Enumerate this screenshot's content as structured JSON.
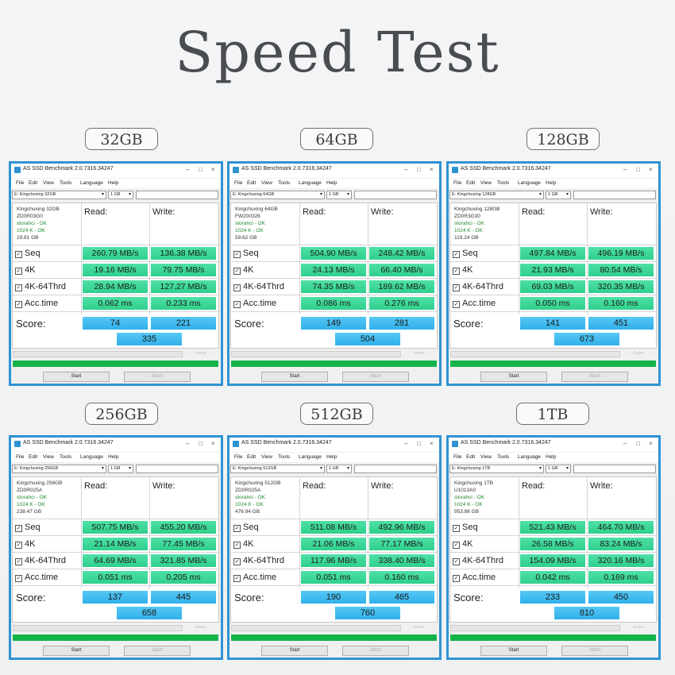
{
  "title": "Speed Test",
  "window_title": "AS SSD Benchmark 2.0.7316.34247",
  "menu": [
    "File",
    "Edit",
    "View",
    "Tools",
    "Language",
    "Help"
  ],
  "size_select": "1 GB",
  "column_read": "Read:",
  "column_write": "Write:",
  "row_labels": [
    "Seq",
    "4K",
    "4K-64Thrd",
    "Acc.time"
  ],
  "score_label": "Score:",
  "elapsed_time": "-:--:--",
  "start_button": "Start",
  "abort_button": "Abort",
  "benchmarks": [
    {
      "capacity": "32GB",
      "drive": "E: Kingchuxing 32GB",
      "model": "Kingchuxing 32GB",
      "firmware": "ZD0R03G0",
      "driver": "storahci - OK",
      "align": "1024 K - OK",
      "size": "29.81 GB",
      "seq_read": "260.79 MB/s",
      "seq_write": "136.38 MB/s",
      "k4_read": "19.16 MB/s",
      "k4_write": "79.75 MB/s",
      "k64_read": "28.94 MB/s",
      "k64_write": "127.27 MB/s",
      "acc_read": "0.062 ms",
      "acc_write": "0.233 ms",
      "score_read": "74",
      "score_write": "221",
      "score_total": "335"
    },
    {
      "capacity": "64GB",
      "drive": "E: Kingchuxing 64GB",
      "model": "Kingchuxing 64GB",
      "firmware": "FW200326",
      "driver": "storahci - OK",
      "align": "1024 K - OK",
      "size": "59.62 GB",
      "seq_read": "504.90 MB/s",
      "seq_write": "248.42 MB/s",
      "k4_read": "24.13 MB/s",
      "k4_write": "66.40 MB/s",
      "k64_read": "74.35 MB/s",
      "k64_write": "189.62 MB/s",
      "acc_read": "0.086 ms",
      "acc_write": "0.276 ms",
      "score_read": "149",
      "score_write": "281",
      "score_total": "504"
    },
    {
      "capacity": "128GB",
      "drive": "E: Kingchuxing 128GB",
      "model": "Kingchuxing 128GB",
      "firmware": "ZD0R3G30",
      "driver": "storahci - OK",
      "align": "1024 K - OK",
      "size": "119.24 GB",
      "seq_read": "497.84 MB/s",
      "seq_write": "496.19 MB/s",
      "k4_read": "21.93 MB/s",
      "k4_write": "80.54 MB/s",
      "k64_read": "69.03 MB/s",
      "k64_write": "320.35 MB/s",
      "acc_read": "0.050 ms",
      "acc_write": "0.160 ms",
      "score_read": "141",
      "score_write": "451",
      "score_total": "673"
    },
    {
      "capacity": "256GB",
      "drive": "E: Kingchuxing 256GB",
      "model": "Kingchuxing 256GB",
      "firmware": "ZD0R025A",
      "driver": "storahci - OK",
      "align": "1024 K - OK",
      "size": "238.47 GB",
      "seq_read": "507.75 MB/s",
      "seq_write": "455.20 MB/s",
      "k4_read": "21.14 MB/s",
      "k4_write": "77.45 MB/s",
      "k64_read": "64.69 MB/s",
      "k64_write": "321.85 MB/s",
      "acc_read": "0.051 ms",
      "acc_write": "0.205 ms",
      "score_read": "137",
      "score_write": "445",
      "score_total": "658"
    },
    {
      "capacity": "512GB",
      "drive": "E: Kingchuxing 512GB",
      "model": "Kingchuxing 512GB",
      "firmware": "ZD0R025A",
      "driver": "storahci - OK",
      "align": "1024 K - OK",
      "size": "476.94 GB",
      "seq_read": "511.08 MB/s",
      "seq_write": "492.96 MB/s",
      "k4_read": "21.06 MB/s",
      "k4_write": "77.17 MB/s",
      "k64_read": "117.96 MB/s",
      "k64_write": "338.40 MB/s",
      "acc_read": "0.051 ms",
      "acc_write": "0.160 ms",
      "score_read": "190",
      "score_write": "465",
      "score_total": "760"
    },
    {
      "capacity": "1TB",
      "drive": "E: Kingchuxing 1TB",
      "model": "Kingchuxing 1TB",
      "firmware": "U1013A0",
      "driver": "storahci - OK",
      "align": "1024 K - OK",
      "size": "953.86 GB",
      "seq_read": "521.43 MB/s",
      "seq_write": "464.70 MB/s",
      "k4_read": "26.58 MB/s",
      "k4_write": "83.24 MB/s",
      "k64_read": "154.09 MB/s",
      "k64_write": "320.16 MB/s",
      "acc_read": "0.042 ms",
      "acc_write": "0.169 ms",
      "score_read": "233",
      "score_write": "450",
      "score_total": "810"
    }
  ]
}
